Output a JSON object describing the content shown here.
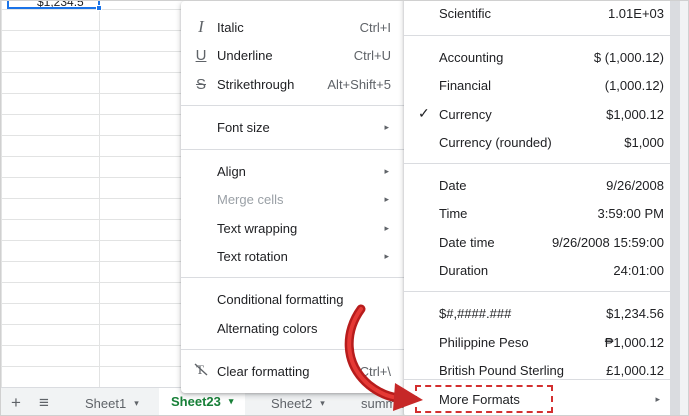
{
  "cell": {
    "text": "$1,234.5"
  },
  "bottom_bar": {
    "add_icon": "+",
    "list_icon": "≡",
    "tabs": [
      "Sheet1",
      "Sheet23",
      "Sheet2",
      "summa"
    ],
    "caret": "▾"
  },
  "format_menu": {
    "items": [
      {
        "label": "Italic",
        "shortcut": "Ctrl+I",
        "icon": "I"
      },
      {
        "label": "Underline",
        "shortcut": "Ctrl+U",
        "icon": "U"
      },
      {
        "label": "Strikethrough",
        "shortcut": "Alt+Shift+5",
        "icon": "S"
      },
      {
        "label": "Font size"
      },
      {
        "label": "Align"
      },
      {
        "label": "Merge cells"
      },
      {
        "label": "Text wrapping"
      },
      {
        "label": "Text rotation"
      },
      {
        "label": "Conditional formatting"
      },
      {
        "label": "Alternating colors"
      },
      {
        "label": "Clear formatting",
        "shortcut": "Ctrl+\\"
      }
    ],
    "submenu_arrow": "▸"
  },
  "number_menu": {
    "items": [
      {
        "label": "Scientific",
        "value": "1.01E+03"
      },
      {
        "label": "Accounting",
        "value": "$ (1,000.12)"
      },
      {
        "label": "Financial",
        "value": "(1,000.12)"
      },
      {
        "label": "Currency",
        "value": "$1,000.12",
        "checked": true
      },
      {
        "label": "Currency (rounded)",
        "value": "$1,000"
      },
      {
        "label": "Date",
        "value": "9/26/2008"
      },
      {
        "label": "Time",
        "value": "3:59:00 PM"
      },
      {
        "label": "Date time",
        "value": "9/26/2008 15:59:00"
      },
      {
        "label": "Duration",
        "value": "24:01:00"
      },
      {
        "label": "$#,####.###",
        "value": "$1,234.56"
      },
      {
        "label": "Philippine Peso",
        "value": "₱1,000.12"
      },
      {
        "label": "British Pound Sterling",
        "value": "£1,000.12"
      },
      {
        "label": "More Formats"
      }
    ],
    "check": "✓",
    "submenu_arrow": "▸"
  },
  "colors": {
    "accent": "#1a73e8",
    "active_tab": "#188038",
    "highlight": "#d32f2f"
  }
}
